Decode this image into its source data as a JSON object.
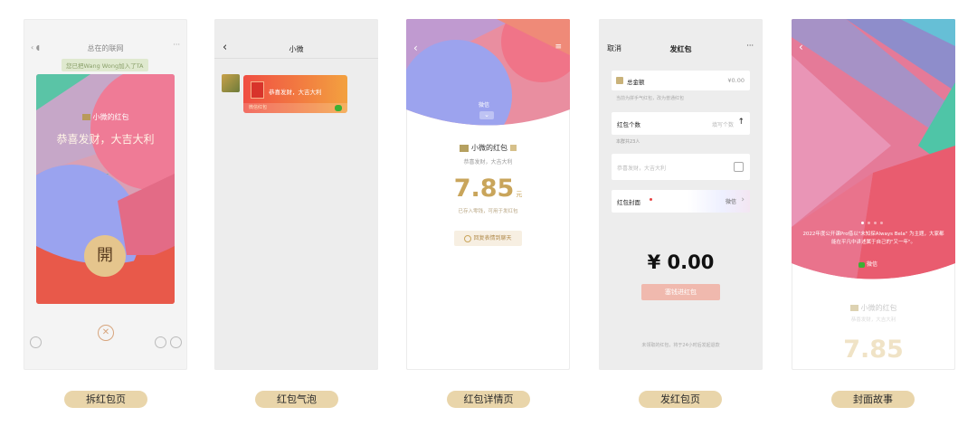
{
  "captions": [
    "拆红包页",
    "红包气泡",
    "红包详情页",
    "发红包页",
    "封面故事"
  ],
  "open_page": {
    "chat_title": "总在的联网",
    "notice": "您已把Wang Wong加入了TA",
    "sender": "小微的红包",
    "greeting": "恭喜发财，大吉大利",
    "open_char": "開"
  },
  "bubble_page": {
    "title": "小微",
    "bubble_text": "恭喜发财，大吉大利",
    "bubble_footer": "微信红包"
  },
  "detail_page": {
    "tag": "微信",
    "sender": "小微的红包",
    "greeting": "恭喜发财，大吉大利",
    "amount": "7.85",
    "unit": "元",
    "note": "已存入零钱，可用于发红包",
    "reply": "回复表情到聊天"
  },
  "send_page": {
    "cancel": "取消",
    "title": "发红包",
    "more": "···",
    "total_label": "总金额",
    "total_value": "¥0.00",
    "hint": "当前为拼手气红包，改为普通红包",
    "count_label": "红包个数",
    "count_placeholder": "填写个数",
    "group_info": "本群共23人",
    "message_placeholder": "恭喜发财，大吉大利",
    "cover_label": "红包封面",
    "cover_value": "微信",
    "amount": "¥ 0.00",
    "submit": "塞钱进红包",
    "footer": "未领取的红包，将于24小时后发起退款"
  },
  "story_page": {
    "story_text": "2022年度公开课Pro借以\"未知探Always Bela\" 为主题，大家都能在平凡中讲述属于自己的\"又一年\"。",
    "tag": "微信",
    "sender": "小微的红包",
    "greeting": "恭喜发财，大吉大利",
    "amount": "7.85"
  },
  "colors": {
    "caption_bg": "#e9d5aa",
    "gold": "#c9a55b",
    "red": "#e8594a",
    "coin": "#e5c58d"
  }
}
